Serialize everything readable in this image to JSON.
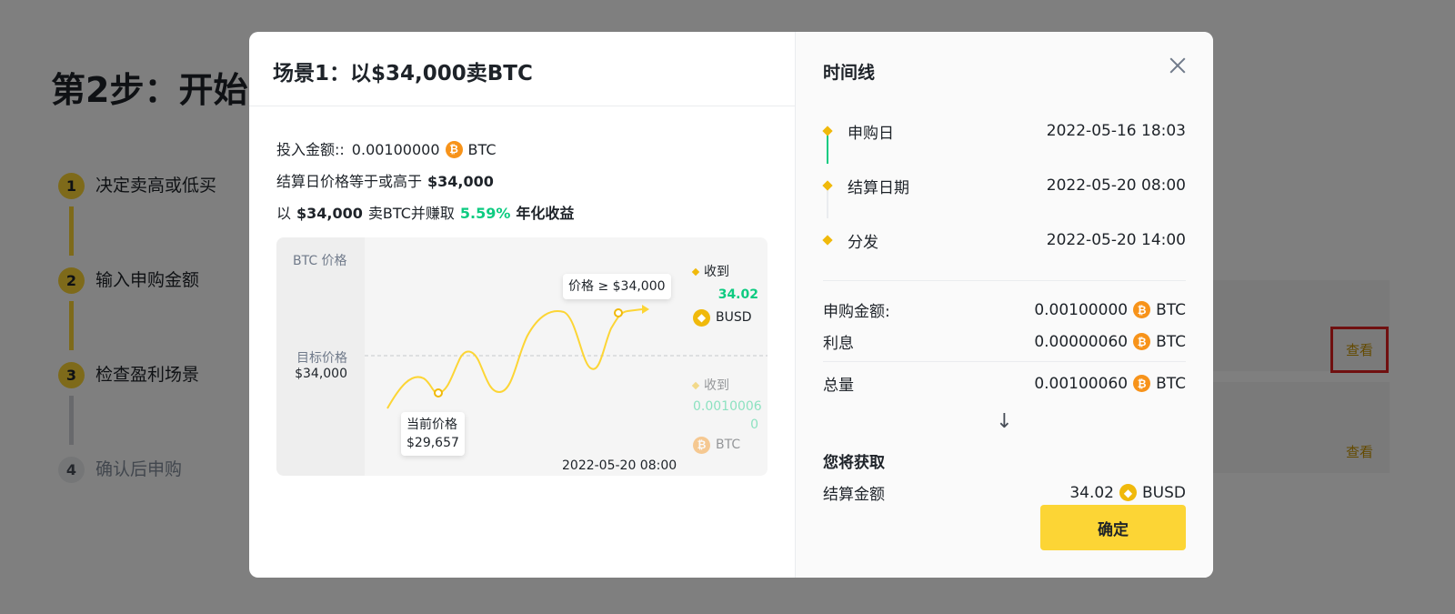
{
  "background": {
    "title": "第2步：开始",
    "steps": [
      {
        "num": "1",
        "label": "决定卖高或低买"
      },
      {
        "num": "2",
        "label": "输入申购金额"
      },
      {
        "num": "3",
        "label": "检查盈利场景"
      },
      {
        "num": "4",
        "label": "确认后申购"
      }
    ],
    "view_label": "查看"
  },
  "modal": {
    "left": {
      "title": "场景1：以$34,000卖BTC",
      "invest_label": "投入金额::",
      "invest_amount": "0.00100000",
      "invest_coin": "BTC",
      "cond_prefix": "结算日价格等于或高于",
      "cond_price": "$34,000",
      "sell_prefix": "以",
      "sell_price": "$34,000",
      "sell_middle": "卖BTC并赚取",
      "apy": "5.59%",
      "apy_suffix": "年化收益",
      "chart": {
        "y_title": "BTC 价格",
        "target_label": "目标价格",
        "target_value": "$34,000",
        "current_label": "当前价格",
        "current_value": "$29,657",
        "above_tip": "价格 ≥ $34,000",
        "date": "2022-05-20 08:00",
        "receive_label": "收到",
        "receive_busd_amount": "34.02",
        "receive_busd_coin": "BUSD",
        "receive_btc_amount_1": "0.0010006",
        "receive_btc_amount_2": "0",
        "receive_btc_coin": "BTC"
      }
    },
    "right": {
      "title": "时间线",
      "timeline": [
        {
          "label": "申购日",
          "time": "2022-05-16 18:03"
        },
        {
          "label": "结算日期",
          "time": "2022-05-20 08:00"
        },
        {
          "label": "分发",
          "time": "2022-05-20 14:00"
        }
      ],
      "subscribe_label": "申购金额:",
      "subscribe_value": "0.00100000",
      "interest_label": "利息",
      "interest_value": "0.00000060",
      "total_label": "总量",
      "total_value": "0.00100060",
      "coin": "BTC",
      "get_title": "您将获取",
      "settle_label": "结算金额",
      "settle_value": "34.02",
      "settle_coin": "BUSD",
      "confirm_label": "确定"
    }
  },
  "colors": {
    "accent": "#fcd535",
    "positive": "#0ecb81",
    "btc": "#f7931a",
    "busd": "#f0b90b",
    "highlight_box": "#e02020"
  }
}
